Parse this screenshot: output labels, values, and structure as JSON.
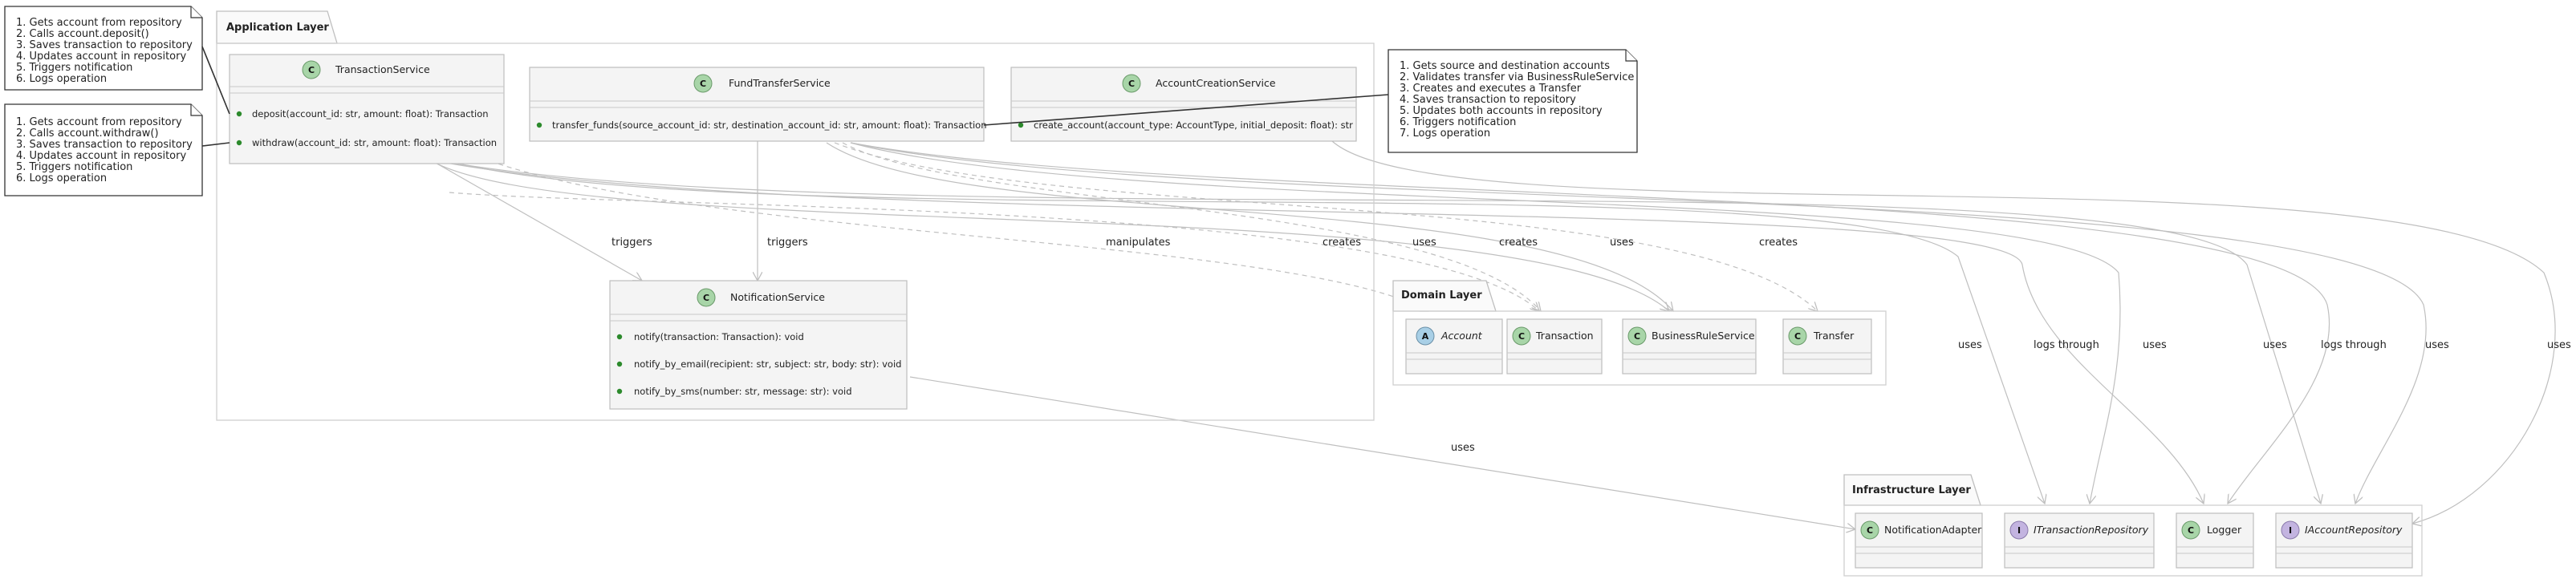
{
  "packages": {
    "application": {
      "title": "Application Layer"
    },
    "domain": {
      "title": "Domain Layer"
    },
    "infrastructure": {
      "title": "Infrastructure Layer"
    }
  },
  "classes": {
    "transaction_service": {
      "name": "TransactionService",
      "kind": "C",
      "methods": [
        "deposit(account_id: str, amount: float): Transaction",
        "withdraw(account_id: str, amount: float): Transaction"
      ]
    },
    "fund_transfer_service": {
      "name": "FundTransferService",
      "kind": "C",
      "methods": [
        "transfer_funds(source_account_id: str, destination_account_id: str, amount: float): Transaction"
      ]
    },
    "account_creation_service": {
      "name": "AccountCreationService",
      "kind": "C",
      "methods": [
        "create_account(account_type: AccountType, initial_deposit: float): str"
      ]
    },
    "notification_service": {
      "name": "NotificationService",
      "kind": "C",
      "methods": [
        "notify(transaction: Transaction): void",
        "notify_by_email(recipient: str, subject: str, body: str): void",
        "notify_by_sms(number: str, message: str): void"
      ]
    },
    "account": {
      "name": "Account",
      "kind": "A"
    },
    "transaction": {
      "name": "Transaction",
      "kind": "C"
    },
    "business_rule_service": {
      "name": "BusinessRuleService",
      "kind": "C"
    },
    "transfer": {
      "name": "Transfer",
      "kind": "C"
    },
    "notification_adapter": {
      "name": "NotificationAdapter",
      "kind": "C"
    },
    "itransaction_repository": {
      "name": "ITransactionRepository",
      "kind": "I"
    },
    "logger": {
      "name": "Logger",
      "kind": "C"
    },
    "iaccount_repository": {
      "name": "IAccountRepository",
      "kind": "I"
    }
  },
  "notes": {
    "deposit": {
      "lines": [
        "1. Gets account from repository",
        "2. Calls account.deposit()",
        "3. Saves transaction to repository",
        "4. Updates account in repository",
        "5. Triggers notification",
        "6. Logs operation"
      ]
    },
    "withdraw": {
      "lines": [
        "1. Gets account from repository",
        "2. Calls account.withdraw()",
        "3. Saves transaction to repository",
        "4. Updates account in repository",
        "5. Triggers notification",
        "6. Logs operation"
      ]
    },
    "transfer": {
      "lines": [
        "1. Gets source and destination accounts",
        "2. Validates transfer via BusinessRuleService",
        "3. Creates and executes a Transfer",
        "4. Saves transaction to repository",
        "5. Updates both accounts in repository",
        "6. Triggers notification",
        "7. Logs operation"
      ]
    }
  },
  "relations": {
    "ts_triggers": "triggers",
    "fts_triggers": "triggers",
    "ts_manipulates": "manipulates",
    "ts_creates": "creates",
    "ts_uses_brs": "uses",
    "fts_creates": "creates",
    "fts_uses_brs": "uses",
    "fts_creates_transfer": "creates",
    "uses_1": "uses",
    "logs_through_1": "logs through",
    "uses_2": "uses",
    "uses_3": "uses",
    "logs_through_2": "logs through",
    "uses_4": "uses",
    "uses_5": "uses",
    "ns_uses": "uses"
  }
}
